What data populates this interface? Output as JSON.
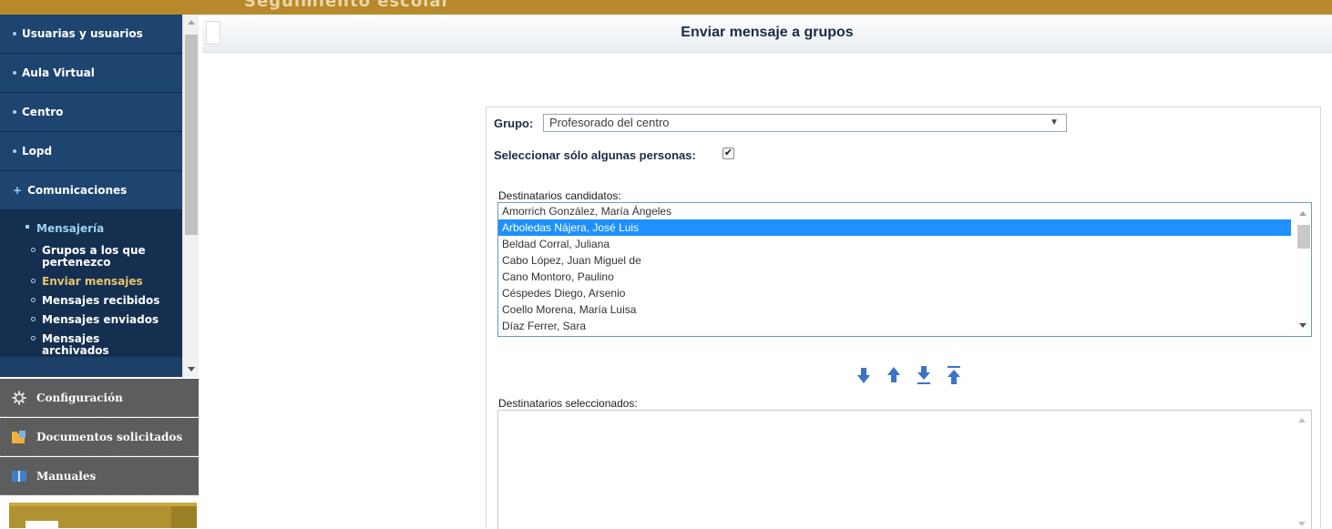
{
  "top_bar": {
    "clipped_text": "Seguimiento escolar"
  },
  "sidebar": {
    "items": [
      {
        "label": "Usuarias y usuarios"
      },
      {
        "label": "Aula Virtual"
      },
      {
        "label": "Centro"
      },
      {
        "label": "Lopd"
      },
      {
        "label": "Comunicaciones",
        "expanded": true
      }
    ],
    "submenu": {
      "title": "Mensajería",
      "links": [
        {
          "label": "Grupos a los que pertenezco"
        },
        {
          "label": "Enviar mensajes",
          "active": true
        },
        {
          "label": "Mensajes recibidos"
        },
        {
          "label": "Mensajes enviados"
        },
        {
          "label": "Mensajes archivados"
        }
      ]
    },
    "bottom_items": [
      {
        "label": "Configuración",
        "icon": "gear-icon"
      },
      {
        "label": "Documentos solicitados",
        "icon": "folder-documents-icon"
      },
      {
        "label": "Manuales",
        "icon": "book-icon"
      }
    ],
    "colors": {
      "nav_bg": "#1e4470",
      "active_link": "#e7c46a",
      "dark_bg": "#5d5d5d",
      "gold": "#b8892a"
    }
  },
  "main": {
    "title": "Enviar mensaje a grupos",
    "grupo_label": "Grupo:",
    "grupo_value": "Profesorado del centro",
    "select_some_label": "Seleccionar sólo algunas personas:",
    "select_some_checked": true,
    "candidates_label": "Destinatarios candidatos:",
    "candidates": [
      "Amorrich González, María Ángeles",
      "Arboledas Nájera, José Luis",
      "Beldad Corral, Juliana",
      "Cabo López, Juan Miguel de",
      "Cano Montoro, Paulino",
      "Céspedes Diego, Arsenio",
      "Coello Morena, María Luisa",
      "Díaz Ferrer, Sara"
    ],
    "selected_candidate": "Arboledas Nájera, José Luis",
    "movers": [
      {
        "icon": "arrow-down-icon"
      },
      {
        "icon": "arrow-up-icon"
      },
      {
        "icon": "arrow-down-all-icon"
      },
      {
        "icon": "arrow-up-all-icon"
      }
    ],
    "selected_label": "Destinatarios seleccionados:"
  }
}
